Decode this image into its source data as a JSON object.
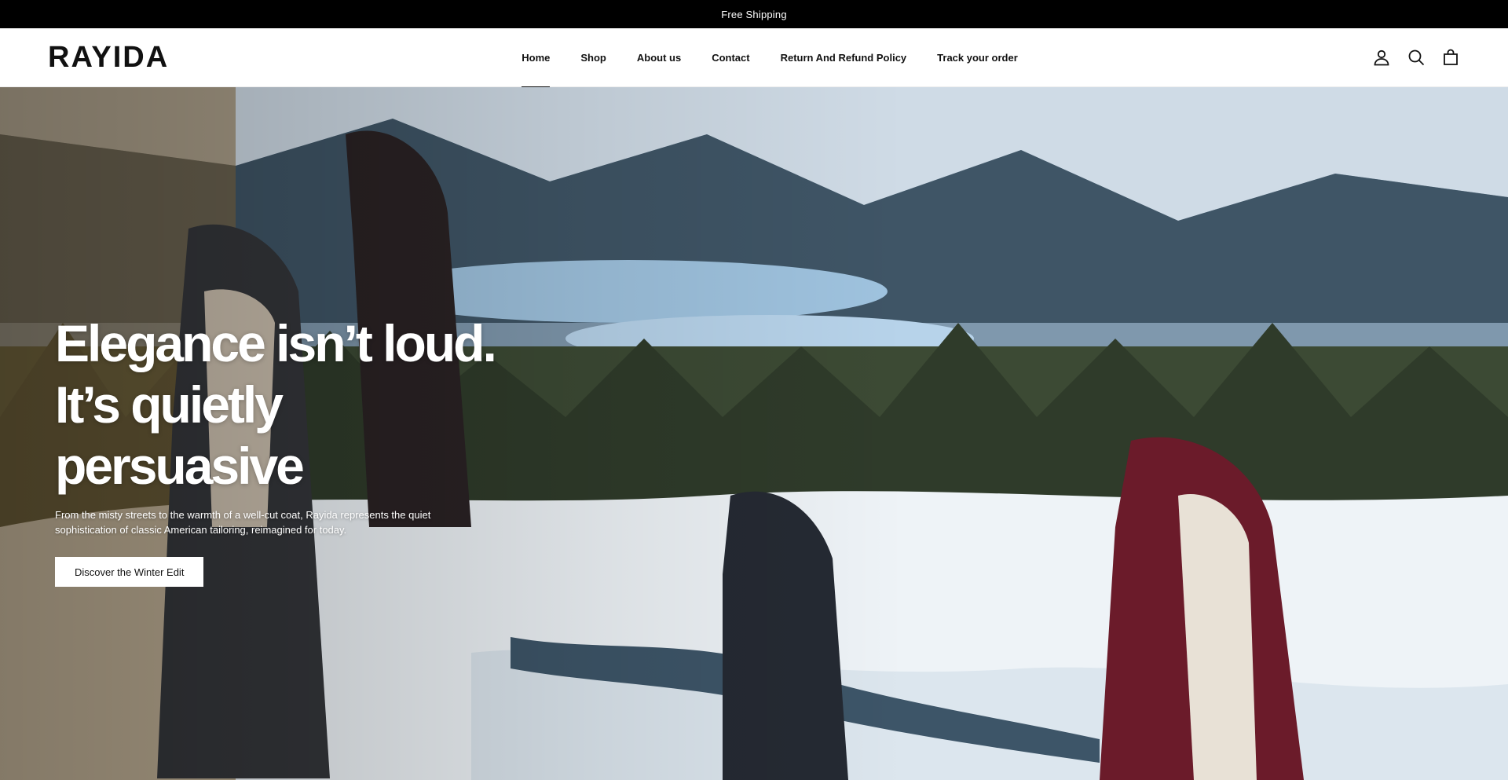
{
  "announcement": {
    "text": "Free Shipping"
  },
  "header": {
    "logo": "RAYIDA",
    "nav": [
      {
        "label": "Home",
        "active": true
      },
      {
        "label": "Shop"
      },
      {
        "label": "About us"
      },
      {
        "label": "Contact"
      },
      {
        "label": "Return And Refund Policy"
      },
      {
        "label": "Track your order"
      }
    ],
    "icons": [
      "account-icon",
      "search-icon",
      "cart-icon"
    ]
  },
  "hero": {
    "title_lines": [
      "Elegance isn’t loud.",
      "It’s quietly",
      "persuasive"
    ],
    "text": "From the misty streets to the warmth of a well-cut coat, Rayida represents the quiet sophistication of classic American tailoring, reimagined for today.",
    "cta_label": "Discover the Winter Edit",
    "image_subject": "winter-mountain-landscape-with-models-in-coats"
  },
  "colors": {
    "announcement_bg": "#000000",
    "header_bg": "#ffffff",
    "text_dark": "#111111",
    "cta_bg": "#ffffff"
  }
}
